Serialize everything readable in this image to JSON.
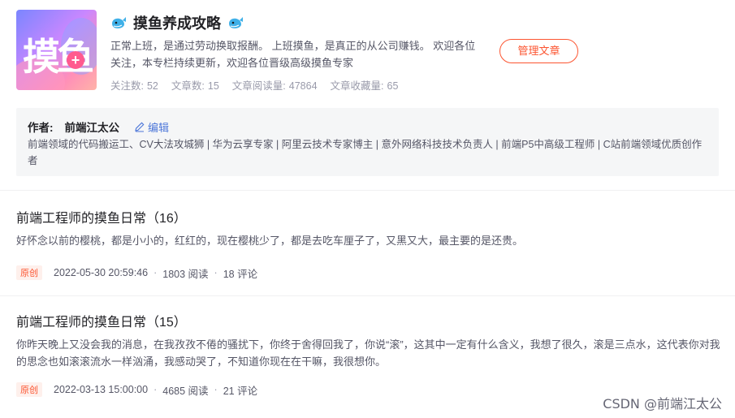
{
  "column": {
    "cover_text": "摸",
    "cover_text2": "鱼",
    "title": "摸鱼养成攻略",
    "emoji_icon": "whale-icon",
    "description": "正常上班，是通过劳动换取报酬。 上班摸鱼，是真正的从公司赚钱。 欢迎各位关注，本专栏持续更新，欢迎各位晋级高级摸鱼专家",
    "manage_button": "管理文章",
    "stats": {
      "followers_label": "关注数:",
      "followers": "52",
      "articles_label": "文章数:",
      "articles": "15",
      "reads_label": "文章阅读量:",
      "reads": "47864",
      "favorites_label": "文章收藏量:",
      "favorites": "65"
    }
  },
  "author": {
    "label": "作者:",
    "name": "前端江太公",
    "edit_label": "编辑",
    "bio": "前端领域的代码搬运工、CV大法攻城狮 | 华为云享专家 | 阿里云技术专家博主 | 意外网络科技技术负责人 | 前端P5中高级工程师 | C站前端领域优质创作者"
  },
  "articles": [
    {
      "title": "前端工程师的摸鱼日常（16）",
      "summary": "好怀念以前的樱桃，都是小小的，红红的，现在樱桃少了，都是去吃车厘子了，又黑又大，最主要的是还贵。",
      "badge": "原创",
      "date": "2022-05-30 20:59:46",
      "reads": "1803 阅读",
      "comments": "18 评论"
    },
    {
      "title": "前端工程师的摸鱼日常（15）",
      "summary": "你昨天晚上又没会我的消息，在我孜孜不倦的骚扰下，你终于舍得回我了，你说“滚”，这其中一定有什么含义，我想了很久，滚是三点水，这代表你对我的思念也如滚滚流水一样汹涌，我感动哭了，不知道你现在在干嘛，我很想你。",
      "badge": "原创",
      "date": "2022-03-13 15:00:00",
      "reads": "4685 阅读",
      "comments": "21 评论"
    }
  ],
  "meta_separator": "·",
  "watermark": "CSDN @前端江太公",
  "colors": {
    "accent": "#fc5531",
    "link": "#4d77d9",
    "muted": "#999aaa",
    "author_bg": "#f5f6f7"
  }
}
